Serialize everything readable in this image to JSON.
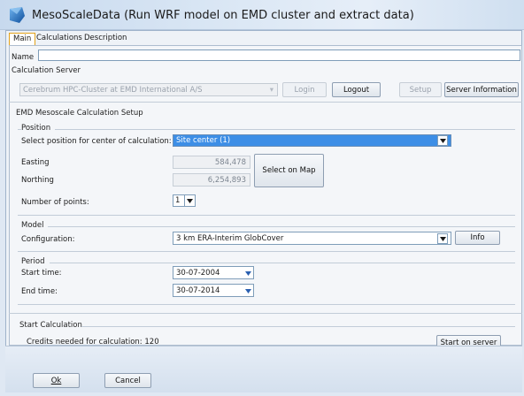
{
  "window": {
    "title": "MesoScaleData (Run WRF model on EMD cluster and extract data)"
  },
  "tabs": [
    {
      "label": "Main",
      "active": true
    },
    {
      "label": "Calculations",
      "active": false
    },
    {
      "label": "Description",
      "active": false
    }
  ],
  "name_field": {
    "label": "Name",
    "value": ""
  },
  "calculation_server": {
    "label": "Calculation Server",
    "server_value": "Cerebrum HPC-Cluster at EMD International A/S",
    "login_label": "Login",
    "logout_label": "Logout",
    "setup_label": "Setup",
    "server_info_label": "Server Information"
  },
  "setup": {
    "title": "EMD Mesoscale Calculation Setup",
    "position": {
      "title": "Position",
      "select_label": "Select position for center of calculation:",
      "select_value": "Site center (1)",
      "easting_label": "Easting",
      "easting_value": "584,478",
      "northing_label": "Northing",
      "northing_value": "6,254,893",
      "select_on_map_label": "Select on Map",
      "num_points_label": "Number of points:",
      "num_points_value": "1"
    },
    "model": {
      "title": "Model",
      "config_label": "Configuration:",
      "config_value": "3 km ERA-Interim GlobCover",
      "info_label": "Info"
    },
    "period": {
      "title": "Period",
      "start_label": "Start time:",
      "start_value": "30-07-2004",
      "end_label": "End time:",
      "end_value": "30-07-2014"
    }
  },
  "start_calculation": {
    "title": "Start Calculation",
    "credits_text": "Credits needed for calculation: 120",
    "start_button_label": "Start on server"
  },
  "footer": {
    "ok_label": "Ok",
    "cancel_label": "Cancel"
  },
  "colors": {
    "selected_combo": "#3d8ee6",
    "active_tab_border": "#e3a21a",
    "window_bg": "#dfe8f3"
  },
  "icons": {
    "app": "app-icon",
    "dropdown": "chevron-down-icon"
  }
}
